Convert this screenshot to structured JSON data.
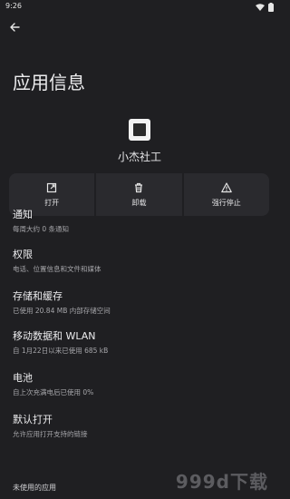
{
  "status": {
    "time": "9:26"
  },
  "header": {
    "title": "应用信息"
  },
  "app": {
    "name": "小杰社工"
  },
  "actions": [
    {
      "label": "打开",
      "icon": "open-external-icon"
    },
    {
      "label": "卸载",
      "icon": "trash-icon"
    },
    {
      "label": "强行停止",
      "icon": "warning-icon"
    }
  ],
  "settings": [
    {
      "title": "通知",
      "subtitle": "每周大约 0 条通知"
    },
    {
      "title": "权限",
      "subtitle": "电话、位置信息和文件和媒体"
    },
    {
      "title": "存储和缓存",
      "subtitle": "已使用 20.84 MB 内部存储空间"
    },
    {
      "title": "移动数据和 WLAN",
      "subtitle": "自 1月22日以来已使用 685 kB"
    },
    {
      "title": "电池",
      "subtitle": "自上次充满电后已使用 0%"
    },
    {
      "title": "默认打开",
      "subtitle": "允许应用打开支持的链接"
    },
    {
      "title": "未使用的应用",
      "subtitle": ""
    }
  ],
  "watermark": "999d下载"
}
